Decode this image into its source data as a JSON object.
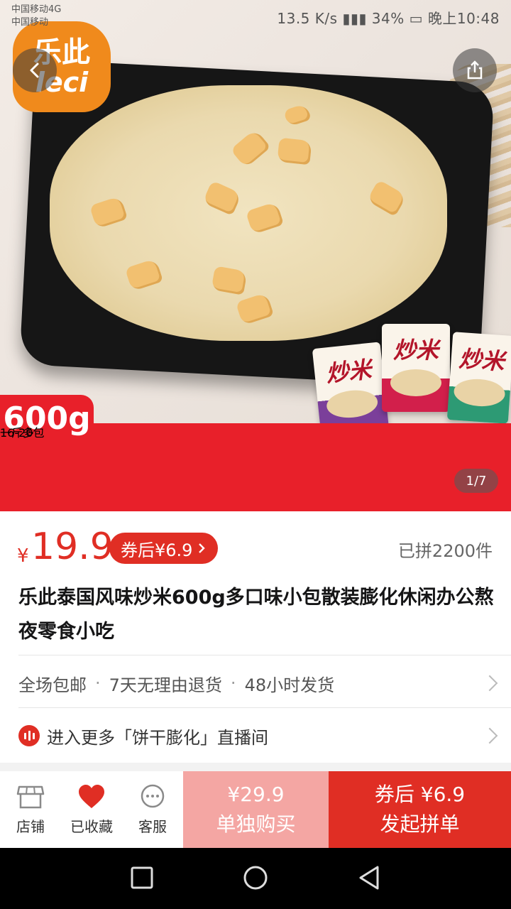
{
  "status_bar": {
    "carrier_top": "中国移动4G",
    "carrier_bottom": "中国移动",
    "speed": "13.5 K/s",
    "battery": "34%",
    "time": "晚上10:48"
  },
  "hero": {
    "logo_cn": "乐此",
    "logo_en": "leci",
    "weight_tag": "600g",
    "banner_left": "一斤多",
    "banner_right": "16-20包",
    "packet_label": "炒米",
    "page_indicator": "1/7"
  },
  "product": {
    "currency": "¥",
    "price": "19.9",
    "coupon_label": "券后¥6.9",
    "sold_text": "已拼2200件",
    "title": "乐此泰国风味炒米600g多口味小包散装膨化休闲办公熬夜零食小吃"
  },
  "services": {
    "items": [
      "全场包邮",
      "7天无理由退货",
      "48小时发货"
    ],
    "separator": "·"
  },
  "live_entry": {
    "text": "进入更多「饼干膨化」直播间"
  },
  "action_bar": {
    "store_label": "店铺",
    "favorite_label": "已收藏",
    "service_label": "客服",
    "single_price": "¥29.9",
    "single_label": "单独购买",
    "group_price": "券后 ¥6.9",
    "group_label": "发起拼单"
  },
  "colors": {
    "accent": "#e02e24",
    "banner_red": "#e8202a",
    "banner_yellow": "#ffe100",
    "single_buy_bg": "#f4a6a3"
  },
  "icons": [
    "back-icon",
    "share-icon",
    "store-icon",
    "heart-icon",
    "chat-icon",
    "live-icon",
    "chevron-right-icon",
    "nav-square-icon",
    "nav-circle-icon",
    "nav-triangle-icon"
  ]
}
